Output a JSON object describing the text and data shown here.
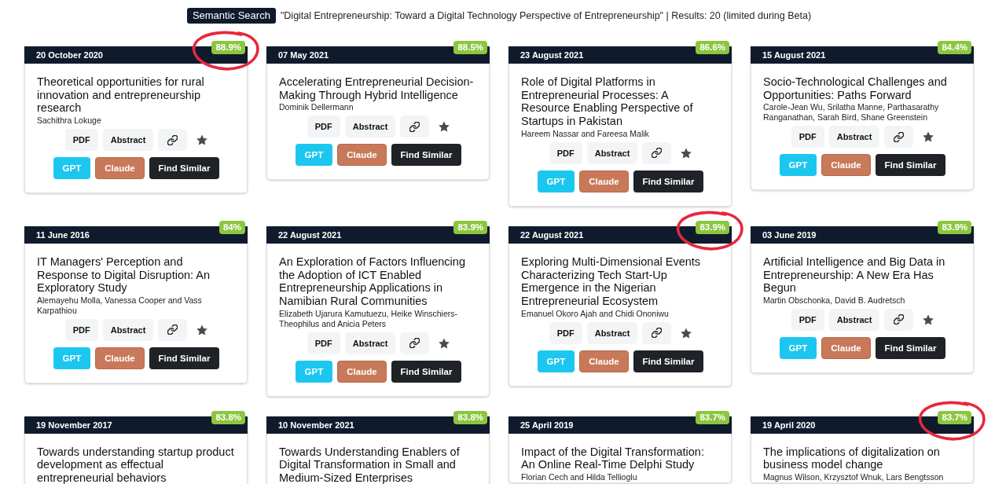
{
  "header": {
    "badge": "Semantic Search",
    "query": "\"Digital Entrepreneurship: Toward a Digital Technology Perspective of Entrepreneurship\" | Results: 20 (limited during Beta)"
  },
  "cards": [
    {
      "date": "20 October 2020",
      "score": "88.9%",
      "circled": true,
      "title": "Theoretical opportunities for rural innovation and entrepreneurship research",
      "authors": "Sachithra Lokuge",
      "tools": [
        {
          "kind": "pdf",
          "label": "PDF"
        },
        {
          "kind": "abstract",
          "label": "Abstract"
        },
        {
          "kind": "link"
        },
        {
          "kind": "star"
        }
      ],
      "actions": [
        {
          "kind": "gpt",
          "label": "GPT"
        },
        {
          "kind": "claude",
          "label": "Claude"
        },
        {
          "kind": "similar",
          "label": "Find Similar"
        }
      ]
    },
    {
      "date": "07 May 2021",
      "score": "88.5%",
      "circled": false,
      "title": "Accelerating Entrepreneurial Decision-Making Through Hybrid Intelligence",
      "authors": "Dominik Dellermann",
      "tools": [
        {
          "kind": "pdf",
          "label": "PDF"
        },
        {
          "kind": "abstract",
          "label": "Abstract"
        },
        {
          "kind": "link"
        },
        {
          "kind": "star"
        }
      ],
      "actions": [
        {
          "kind": "gpt",
          "label": "GPT"
        },
        {
          "kind": "claude",
          "label": "Claude"
        },
        {
          "kind": "similar",
          "label": "Find Similar"
        }
      ]
    },
    {
      "date": "23 August 2021",
      "score": "86.6%",
      "circled": false,
      "title": "Role of Digital Platforms in Entrepreneurial Processes: A Resource Enabling Perspective of Startups in Pakistan",
      "authors": "Hareem Nassar and Fareesa Malik",
      "tools": [
        {
          "kind": "pdf",
          "label": "PDF"
        },
        {
          "kind": "abstract",
          "label": "Abstract"
        },
        {
          "kind": "link"
        },
        {
          "kind": "star"
        }
      ],
      "actions": [
        {
          "kind": "gpt",
          "label": "GPT"
        },
        {
          "kind": "claude",
          "label": "Claude"
        },
        {
          "kind": "similar",
          "label": "Find Similar"
        }
      ]
    },
    {
      "date": "15 August 2021",
      "score": "84.4%",
      "circled": false,
      "title": "Socio-Technological Challenges and Opportunities: Paths Forward",
      "authors": "Carole-Jean Wu, Srilatha Manne, Parthasarathy Ranganathan, Sarah Bird, Shane Greenstein",
      "tools": [
        {
          "kind": "pdf",
          "label": "PDF"
        },
        {
          "kind": "abstract",
          "label": "Abstract"
        },
        {
          "kind": "link"
        },
        {
          "kind": "star"
        }
      ],
      "actions": [
        {
          "kind": "gpt",
          "label": "GPT"
        },
        {
          "kind": "claude",
          "label": "Claude"
        },
        {
          "kind": "similar",
          "label": "Find Similar"
        }
      ]
    },
    {
      "date": "11 June 2016",
      "score": "84%",
      "circled": false,
      "title": "IT Managers' Perception and Response to Digital Disruption: An Exploratory Study",
      "authors": "Alemayehu Molla, Vanessa Cooper and Vass Karpathiou",
      "tools": [
        {
          "kind": "pdf",
          "label": "PDF"
        },
        {
          "kind": "abstract",
          "label": "Abstract"
        },
        {
          "kind": "link"
        },
        {
          "kind": "star"
        }
      ],
      "actions": [
        {
          "kind": "gpt",
          "label": "GPT"
        },
        {
          "kind": "claude",
          "label": "Claude"
        },
        {
          "kind": "similar",
          "label": "Find Similar"
        }
      ]
    },
    {
      "date": "22 August 2021",
      "score": "83.9%",
      "circled": false,
      "title": "An Exploration of Factors Influencing the Adoption of ICT Enabled Entrepreneurship Applications in Namibian Rural Communities",
      "authors": "Elizabeth Ujarura Kamutuezu, Heike Winschiers-Theophilus and Anicia Peters",
      "tools": [
        {
          "kind": "pdf",
          "label": "PDF"
        },
        {
          "kind": "abstract",
          "label": "Abstract"
        },
        {
          "kind": "link"
        },
        {
          "kind": "star"
        }
      ],
      "actions": [
        {
          "kind": "gpt",
          "label": "GPT"
        },
        {
          "kind": "claude",
          "label": "Claude"
        },
        {
          "kind": "similar",
          "label": "Find Similar"
        }
      ]
    },
    {
      "date": "22 August 2021",
      "score": "83.9%",
      "circled": true,
      "title": "Exploring Multi-Dimensional Events Characterizing Tech Start-Up Emergence in the Nigerian Entrepreneurial Ecosystem",
      "authors": "Emanuel Okoro Ajah and Chidi Ononiwu",
      "tools": [
        {
          "kind": "pdf",
          "label": "PDF"
        },
        {
          "kind": "abstract",
          "label": "Abstract"
        },
        {
          "kind": "link"
        },
        {
          "kind": "star"
        }
      ],
      "actions": [
        {
          "kind": "gpt",
          "label": "GPT"
        },
        {
          "kind": "claude",
          "label": "Claude"
        },
        {
          "kind": "similar",
          "label": "Find Similar"
        }
      ]
    },
    {
      "date": "03 June 2019",
      "score": "83.9%",
      "circled": false,
      "title": "Artificial Intelligence and Big Data in Entrepreneurship: A New Era Has Begun",
      "authors": "Martin Obschonka, David B. Audretsch",
      "tools": [
        {
          "kind": "pdf",
          "label": "PDF"
        },
        {
          "kind": "abstract",
          "label": "Abstract"
        },
        {
          "kind": "link"
        },
        {
          "kind": "star"
        }
      ],
      "actions": [
        {
          "kind": "gpt",
          "label": "GPT"
        },
        {
          "kind": "claude",
          "label": "Claude"
        },
        {
          "kind": "similar",
          "label": "Find Similar"
        }
      ]
    },
    {
      "date": "19 November 2017",
      "score": "83.8%",
      "circled": false,
      "title": "Towards understanding startup product development as effectual entrepreneurial behaviors"
    },
    {
      "date": "10 November 2021",
      "score": "83.8%",
      "circled": false,
      "title": "Towards Understanding Enablers of Digital Transformation in Small and Medium-Sized Enterprises"
    },
    {
      "date": "25 April 2019",
      "score": "83.7%",
      "circled": false,
      "title": "Impact of the Digital Transformation: An Online Real-Time Delphi Study",
      "authors": "Florian Cech and Hilda Tellioglu"
    },
    {
      "date": "19 April 2020",
      "score": "83.7%",
      "circled": true,
      "title": "The implications of digitalization on business model change",
      "authors": "Magnus Wilson, Krzysztof Wnuk, Lars Bengtsson"
    }
  ]
}
